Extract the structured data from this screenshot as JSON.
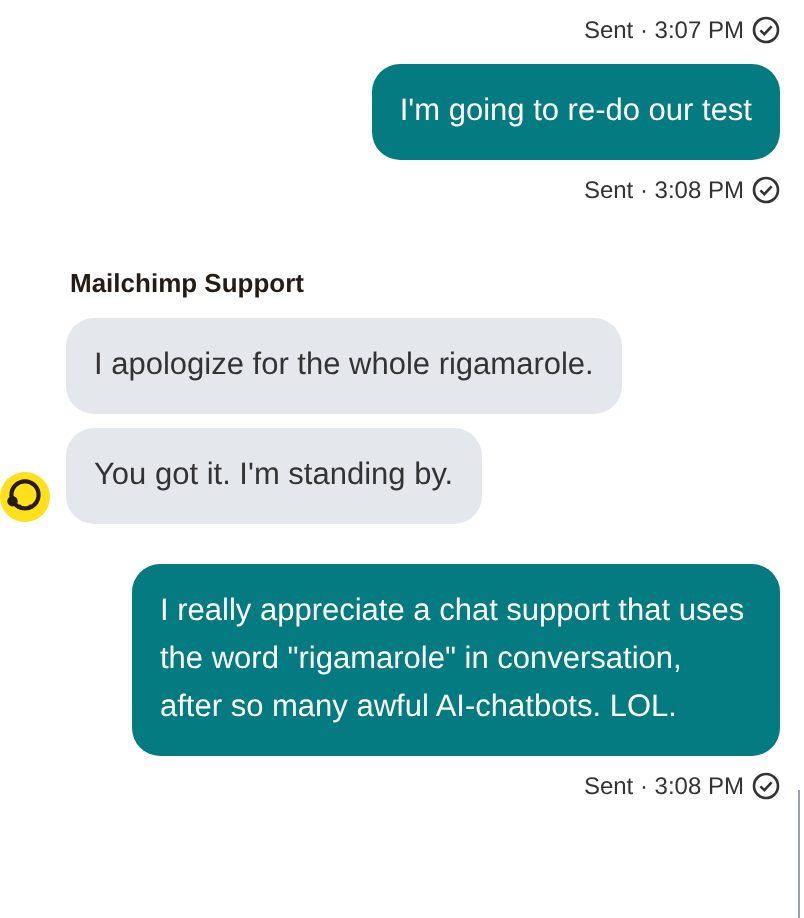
{
  "items": [
    {
      "kind": "status",
      "text": "Sent · 3:07 PM"
    },
    {
      "kind": "outgoing",
      "text": "I'm going to re-do our test"
    },
    {
      "kind": "status",
      "text": "Sent · 3:08 PM"
    },
    {
      "kind": "agent_group",
      "sender": "Mailchimp Support",
      "messages": [
        "I apologize for the whole rigamarole.",
        "You got it. I'm standing by."
      ]
    },
    {
      "kind": "outgoing",
      "text": "I really appreciate a chat support that uses the word \"rigamarole\" in conversation, after so many awful AI-chatbots. LOL."
    },
    {
      "kind": "status",
      "text": "Sent · 3:08 PM"
    }
  ]
}
